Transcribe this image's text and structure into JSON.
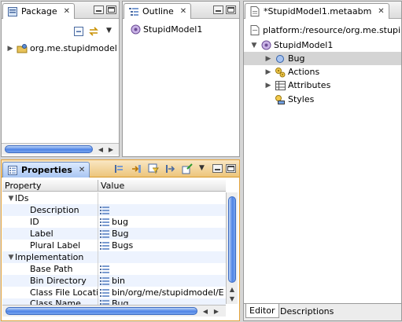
{
  "package_view": {
    "tab_label": "Package",
    "tree": [
      {
        "label": "org.me.stupidmodel"
      }
    ]
  },
  "outline_view": {
    "tab_label": "Outline",
    "tree": [
      {
        "label": "StupidModel1"
      }
    ]
  },
  "editor": {
    "tab_label": "*StupidModel1.metaabm",
    "resource_path": "platform:/resource/org.me.stupi",
    "tree": [
      {
        "label": "StupidModel1"
      },
      {
        "label": "Bug"
      },
      {
        "label": "Actions"
      },
      {
        "label": "Attributes"
      },
      {
        "label": "Styles"
      }
    ],
    "bottom_tabs": [
      "Editor",
      "Descriptions"
    ]
  },
  "properties_view": {
    "tab_label": "Properties",
    "columns": [
      "Property",
      "Value"
    ],
    "rows": [
      {
        "name": "IDs",
        "value": "",
        "group": true
      },
      {
        "name": "Description",
        "value": ""
      },
      {
        "name": "ID",
        "value": "bug"
      },
      {
        "name": "Label",
        "value": "Bug"
      },
      {
        "name": "Plural Label",
        "value": "Bugs"
      },
      {
        "name": "Implementation",
        "value": "",
        "group": true
      },
      {
        "name": "Base Path",
        "value": ""
      },
      {
        "name": "Bin Directory",
        "value": "bin"
      },
      {
        "name": "Class File Locati",
        "value": "bin/org/me/stupidmodel/E"
      },
      {
        "name": "Class Name",
        "value": "Bug"
      }
    ]
  },
  "colors": {
    "selection": "#d4d4d4",
    "scroll_thumb": "#4f84e6",
    "active_tab": "#a9c6f2"
  }
}
